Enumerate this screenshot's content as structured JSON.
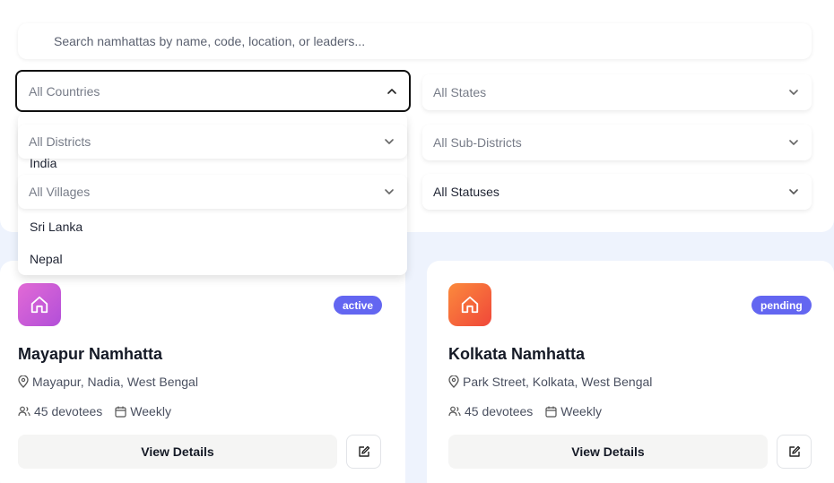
{
  "search": {
    "placeholder": "Search namhattas by name, code, location, or leaders..."
  },
  "filters": {
    "countries": "All Countries",
    "states": "All States",
    "districts": "All Districts",
    "sub_districts": "All Sub-Districts",
    "villages": "All Villages",
    "statuses": "All Statuses"
  },
  "country_dropdown": {
    "options": [
      "India",
      "Sri Lanka",
      "Nepal"
    ]
  },
  "cards": [
    {
      "title": "Mayapur Namhatta",
      "location": "Mayapur, Nadia, West Bengal",
      "devotees": "45 devotees",
      "schedule": "Weekly",
      "status": "active",
      "status_color": "#6366f1",
      "view_label": "View Details"
    },
    {
      "title": "Kolkata Namhatta",
      "location": "Park Street, Kolkata, West Bengal",
      "devotees": "45 devotees",
      "schedule": "Weekly",
      "status": "pending",
      "status_color": "#6366f1",
      "view_label": "View Details"
    }
  ],
  "colors": {
    "card1_icon_gradient": [
      "#e26ad6",
      "#b24fd8"
    ],
    "card2_icon_gradient": [
      "#fb8a3c",
      "#f0473a"
    ]
  }
}
